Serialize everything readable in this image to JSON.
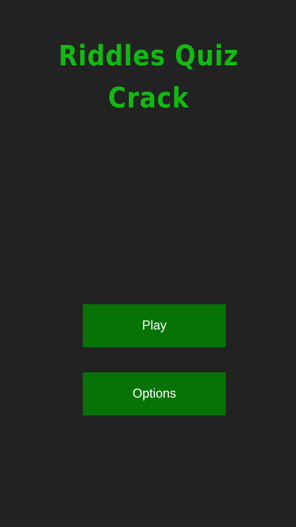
{
  "app": {
    "title_line1": "Riddles Quiz",
    "title_line2": "Crack"
  },
  "menu": {
    "play_label": "Play",
    "options_label": "Options"
  },
  "colors": {
    "background": "#222222",
    "title": "#14b814",
    "button": "#077307",
    "button_text": "#ffffff"
  }
}
